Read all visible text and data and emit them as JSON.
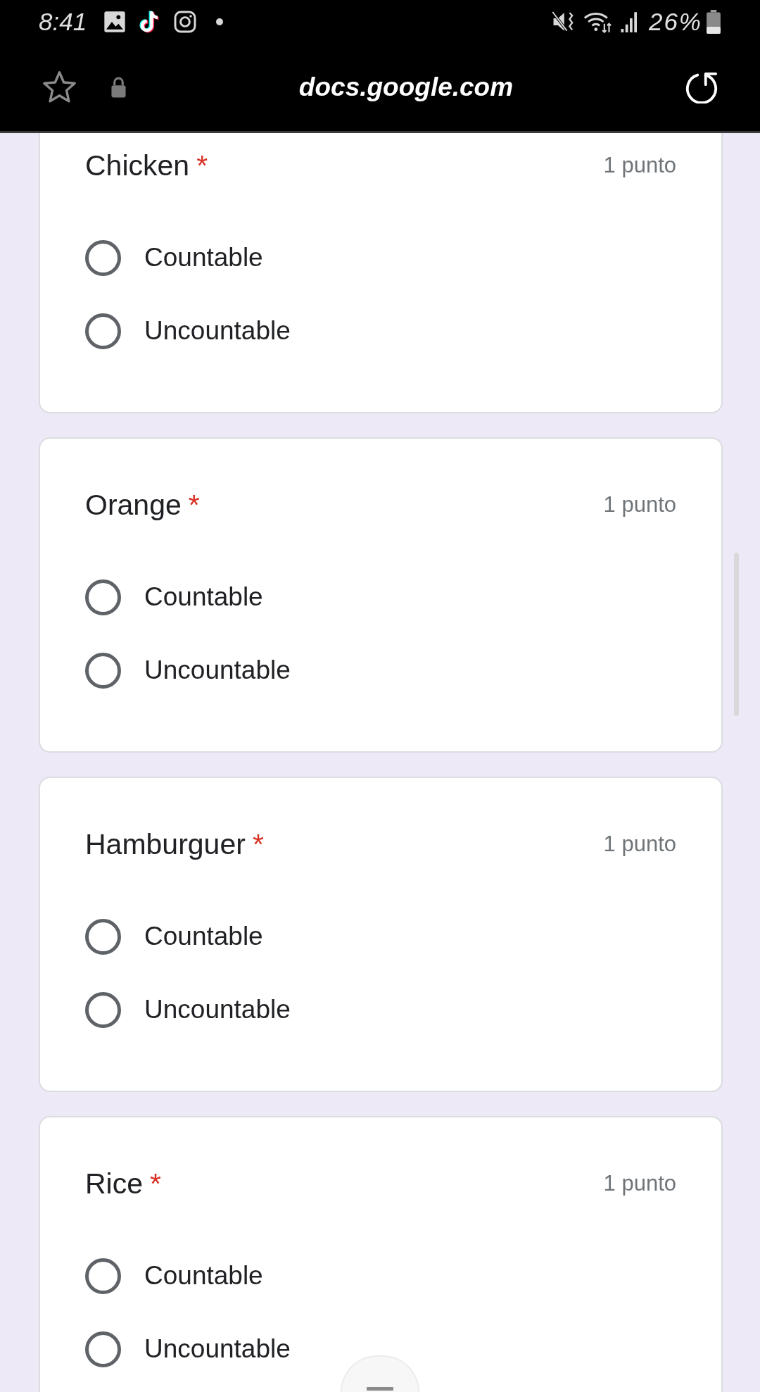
{
  "status_bar": {
    "time": "8:41",
    "battery": "26%"
  },
  "browser_bar": {
    "url": "docs.google.com"
  },
  "questions": [
    {
      "title": "Chicken",
      "required_mark": "*",
      "points": "1 punto",
      "options": [
        {
          "label": "Countable",
          "selected": false
        },
        {
          "label": "Uncountable",
          "selected": false
        }
      ]
    },
    {
      "title": "Orange",
      "required_mark": "*",
      "points": "1 punto",
      "options": [
        {
          "label": "Countable",
          "selected": false
        },
        {
          "label": "Uncountable",
          "selected": false
        }
      ]
    },
    {
      "title": "Hamburguer",
      "required_mark": "*",
      "points": "1 punto",
      "options": [
        {
          "label": "Countable",
          "selected": false
        },
        {
          "label": "Uncountable",
          "selected": false
        }
      ]
    },
    {
      "title": "Rice",
      "required_mark": "*",
      "points": "1 punto",
      "options": [
        {
          "label": "Countable",
          "selected": false
        },
        {
          "label": "Uncountable",
          "selected": false
        }
      ]
    }
  ]
}
